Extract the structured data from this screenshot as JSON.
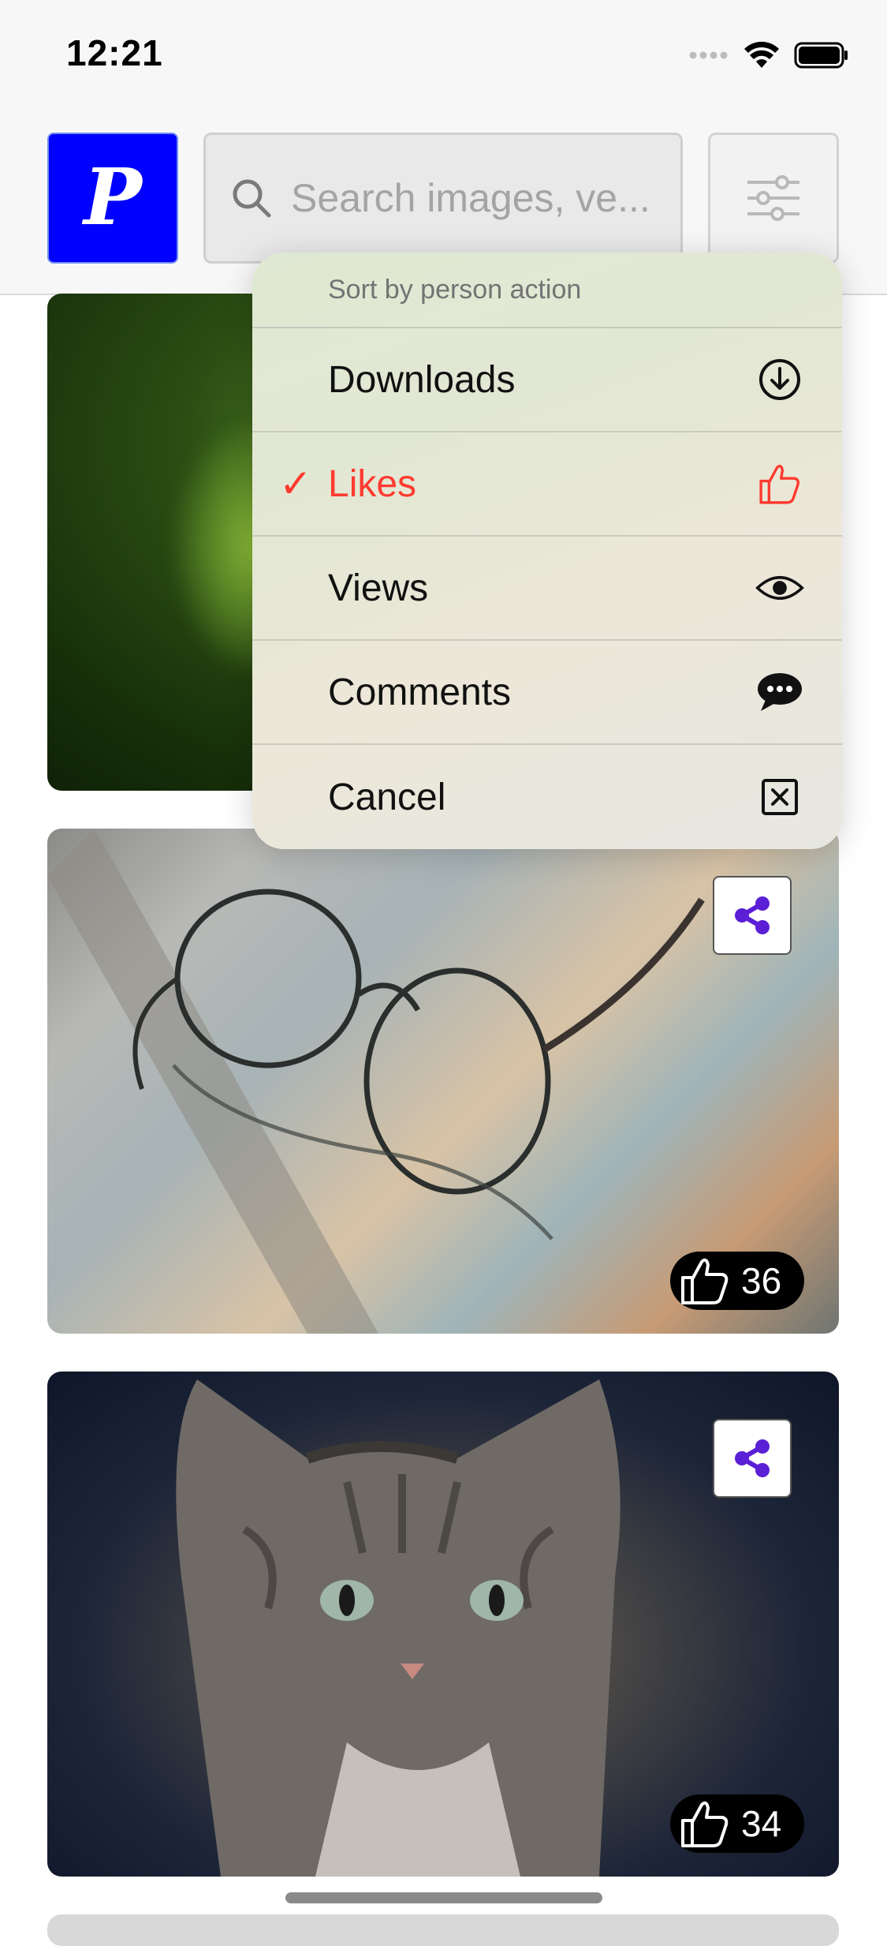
{
  "status_bar": {
    "time": "12:21"
  },
  "header": {
    "logo_letter": "P",
    "search_placeholder": "Search images, ve..."
  },
  "sort_menu": {
    "title": "Sort by person action",
    "selected": "Likes",
    "items": [
      {
        "label": "Downloads",
        "icon": "download-circle-icon"
      },
      {
        "label": "Likes",
        "icon": "thumbs-up-icon",
        "selected": true
      },
      {
        "label": "Views",
        "icon": "eye-icon"
      },
      {
        "label": "Comments",
        "icon": "comment-bubble-icon"
      },
      {
        "label": "Cancel",
        "icon": "close-box-icon"
      }
    ],
    "accent_color": "#ff3b30"
  },
  "feed": {
    "cards": [
      {
        "subject": "green blurred foliage"
      },
      {
        "subject": "glasses on a map",
        "likes": "36"
      },
      {
        "subject": "tabby cat",
        "likes": "34"
      }
    ]
  },
  "colors": {
    "logo_bg": "#0000ff",
    "share_icon": "#5b1fd6",
    "badge_bg": "#000000"
  }
}
